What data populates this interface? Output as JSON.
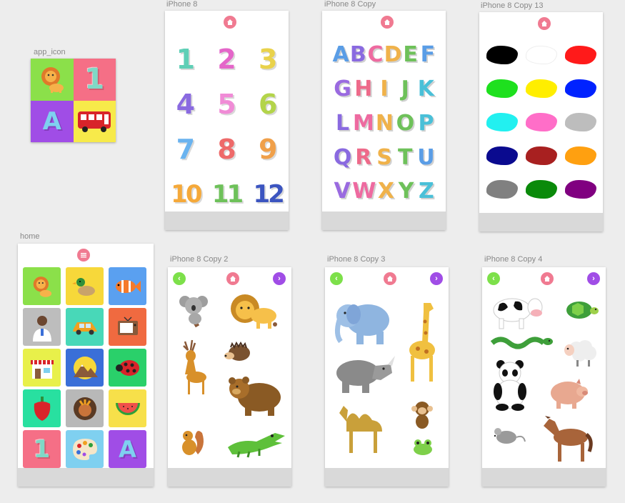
{
  "artboards": {
    "app_icon": "app_icon",
    "iphone8": "iPhone 8",
    "iphone8_copy": "iPhone 8 Copy",
    "iphone8_copy13": "iPhone 8 Copy 13",
    "home": "home",
    "iphone8_copy2": "iPhone 8 Copy 2",
    "iphone8_copy3": "iPhone 8 Copy 3",
    "iphone8_copy4": "iPhone 8 Copy 4"
  },
  "app_icon": {
    "quadrants": [
      {
        "icon": "lion-icon",
        "color": "#8be04a"
      },
      {
        "icon": "number-one-icon",
        "color": "#f56f86",
        "text": "1"
      },
      {
        "icon": "letter-a-icon",
        "color": "#a04de6",
        "text": "A"
      },
      {
        "icon": "bus-icon",
        "color": "#f7ea4a"
      }
    ]
  },
  "numbers": [
    {
      "text": "1",
      "color": "#5fcfb6"
    },
    {
      "text": "2",
      "color": "#e466c9"
    },
    {
      "text": "3",
      "color": "#e9d24b"
    },
    {
      "text": "4",
      "color": "#8a6ae0"
    },
    {
      "text": "5",
      "color": "#f08bd6"
    },
    {
      "text": "6",
      "color": "#b3d44a"
    },
    {
      "text": "7",
      "color": "#6ab3ef"
    },
    {
      "text": "8",
      "color": "#ee6a6a"
    },
    {
      "text": "9",
      "color": "#f0a04a"
    },
    {
      "text": "10",
      "color": "#f5a93a"
    },
    {
      "text": "11",
      "color": "#6ec15a"
    },
    {
      "text": "12",
      "color": "#3c55c0"
    }
  ],
  "letters": [
    {
      "text": "A",
      "color": "#5a9de6"
    },
    {
      "text": "B",
      "color": "#8a6ae0"
    },
    {
      "text": "C",
      "color": "#ee6aa0"
    },
    {
      "text": "D",
      "color": "#f0b24a"
    },
    {
      "text": "E",
      "color": "#6ec15a"
    },
    {
      "text": "F",
      "color": "#5a9de6"
    },
    {
      "text": "G",
      "color": "#9a6ae0"
    },
    {
      "text": "H",
      "color": "#ee6a8a"
    },
    {
      "text": "I",
      "color": "#f0b24a"
    },
    {
      "text": "J",
      "color": "#6ec15a"
    },
    {
      "text": "K",
      "color": "#4ac0d8"
    },
    {
      "text": "L",
      "color": "#8a6ae0"
    },
    {
      "text": "M",
      "color": "#ee6aa0"
    },
    {
      "text": "N",
      "color": "#f0b24a"
    },
    {
      "text": "O",
      "color": "#6ec15a"
    },
    {
      "text": "P",
      "color": "#4ac0d8"
    },
    {
      "text": "Q",
      "color": "#8a6ae0"
    },
    {
      "text": "R",
      "color": "#ee6a8a"
    },
    {
      "text": "S",
      "color": "#f0b24a"
    },
    {
      "text": "T",
      "color": "#6ec15a"
    },
    {
      "text": "U",
      "color": "#5a9de6"
    },
    {
      "text": "V",
      "color": "#9a6ae0"
    },
    {
      "text": "W",
      "color": "#ee6aa0"
    },
    {
      "text": "X",
      "color": "#f0b24a"
    },
    {
      "text": "Y",
      "color": "#6ec15a"
    },
    {
      "text": "Z",
      "color": "#4ac0d8"
    }
  ],
  "colors": [
    "#000000",
    "#ffffff",
    "#ff1a1a",
    "#1ee01e",
    "#ffee00",
    "#0022ff",
    "#22f0f0",
    "#ff6ec8",
    "#bdbdbd",
    "#0a0a8f",
    "#a82020",
    "#ffa010",
    "#808080",
    "#0a8a0a",
    "#800080"
  ],
  "home_tiles": [
    {
      "icon": "lion-icon",
      "color": "#8be04a"
    },
    {
      "icon": "duck-icon",
      "color": "#f7d83a"
    },
    {
      "icon": "fish-icon",
      "color": "#5aa0f0"
    },
    {
      "icon": "doctor-icon",
      "color": "#bdbdbd"
    },
    {
      "icon": "car-icon",
      "color": "#48d8b8"
    },
    {
      "icon": "tv-icon",
      "color": "#f06a40"
    },
    {
      "icon": "shop-icon",
      "color": "#e8f04a"
    },
    {
      "icon": "mountain-icon",
      "color": "#3a6fd8"
    },
    {
      "icon": "ladybug-icon",
      "color": "#2ad06a"
    },
    {
      "icon": "pepper-icon",
      "color": "#28e0a0"
    },
    {
      "icon": "food-icon",
      "color": "#b8b8b8"
    },
    {
      "icon": "watermelon-icon",
      "color": "#f7e04a"
    },
    {
      "icon": "number-one-icon",
      "color": "#f56f86",
      "text": "1"
    },
    {
      "icon": "palette-icon",
      "color": "#7fd0f0"
    },
    {
      "icon": "letter-a-icon",
      "color": "#a04de6",
      "text": "A"
    }
  ],
  "nav": {
    "prev": "‹",
    "next": "›",
    "prev_color": "#7de04a",
    "next_color": "#a04de6",
    "home_color": "#f07a91"
  }
}
